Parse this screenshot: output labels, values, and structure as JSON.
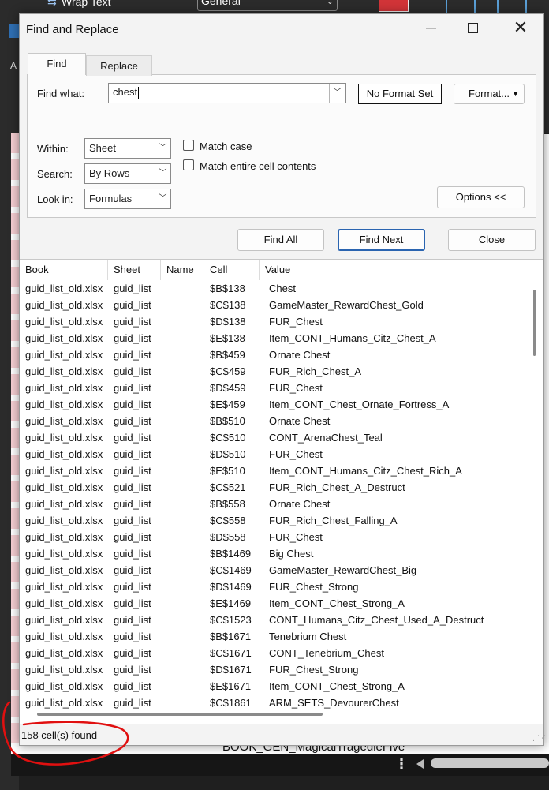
{
  "background": {
    "ribbon_wrap_text": "Wrap Text",
    "ribbon_number_format": "General",
    "left_label": "A",
    "sheet_text_behind": "BOOK_GEN_MagicalTragedieFive"
  },
  "dialog": {
    "title": "Find and Replace",
    "tabs": {
      "find": "Find",
      "replace": "Replace"
    },
    "find_what_label": "Find what:",
    "find_what_value": "chest",
    "no_format_set": "No Format Set",
    "format_button": "Format...",
    "within_label": "Within:",
    "within_value": "Sheet",
    "search_label": "Search:",
    "search_value": "By Rows",
    "lookin_label": "Look in:",
    "lookin_value": "Formulas",
    "match_case": "Match case",
    "match_entire": "Match entire cell contents",
    "options_button": "Options <<",
    "find_all": "Find All",
    "find_next": "Find Next",
    "close": "Close"
  },
  "results": {
    "columns": [
      "Book",
      "Sheet",
      "Name",
      "Cell",
      "Value"
    ],
    "rows": [
      [
        "guid_list_old.xlsx",
        "guid_list",
        "",
        "$B$138",
        "Chest"
      ],
      [
        "guid_list_old.xlsx",
        "guid_list",
        "",
        "$C$138",
        "GameMaster_RewardChest_Gold"
      ],
      [
        "guid_list_old.xlsx",
        "guid_list",
        "",
        "$D$138",
        "FUR_Chest"
      ],
      [
        "guid_list_old.xlsx",
        "guid_list",
        "",
        "$E$138",
        "Item_CONT_Humans_Citz_Chest_A"
      ],
      [
        "guid_list_old.xlsx",
        "guid_list",
        "",
        "$B$459",
        "Ornate Chest"
      ],
      [
        "guid_list_old.xlsx",
        "guid_list",
        "",
        "$C$459",
        "FUR_Rich_Chest_A"
      ],
      [
        "guid_list_old.xlsx",
        "guid_list",
        "",
        "$D$459",
        "FUR_Chest"
      ],
      [
        "guid_list_old.xlsx",
        "guid_list",
        "",
        "$E$459",
        "Item_CONT_Chest_Ornate_Fortress_A"
      ],
      [
        "guid_list_old.xlsx",
        "guid_list",
        "",
        "$B$510",
        "Ornate Chest"
      ],
      [
        "guid_list_old.xlsx",
        "guid_list",
        "",
        "$C$510",
        "CONT_ArenaChest_Teal"
      ],
      [
        "guid_list_old.xlsx",
        "guid_list",
        "",
        "$D$510",
        "FUR_Chest"
      ],
      [
        "guid_list_old.xlsx",
        "guid_list",
        "",
        "$E$510",
        "Item_CONT_Humans_Citz_Chest_Rich_A"
      ],
      [
        "guid_list_old.xlsx",
        "guid_list",
        "",
        "$C$521",
        "FUR_Rich_Chest_A_Destruct"
      ],
      [
        "guid_list_old.xlsx",
        "guid_list",
        "",
        "$B$558",
        "Ornate Chest"
      ],
      [
        "guid_list_old.xlsx",
        "guid_list",
        "",
        "$C$558",
        "FUR_Rich_Chest_Falling_A"
      ],
      [
        "guid_list_old.xlsx",
        "guid_list",
        "",
        "$D$558",
        "FUR_Chest"
      ],
      [
        "guid_list_old.xlsx",
        "guid_list",
        "",
        "$B$1469",
        "Big Chest"
      ],
      [
        "guid_list_old.xlsx",
        "guid_list",
        "",
        "$C$1469",
        "GameMaster_RewardChest_Big"
      ],
      [
        "guid_list_old.xlsx",
        "guid_list",
        "",
        "$D$1469",
        "FUR_Chest_Strong"
      ],
      [
        "guid_list_old.xlsx",
        "guid_list",
        "",
        "$E$1469",
        "Item_CONT_Chest_Strong_A"
      ],
      [
        "guid_list_old.xlsx",
        "guid_list",
        "",
        "$C$1523",
        "CONT_Humans_Citz_Chest_Used_A_Destruct"
      ],
      [
        "guid_list_old.xlsx",
        "guid_list",
        "",
        "$B$1671",
        "Tenebrium Chest"
      ],
      [
        "guid_list_old.xlsx",
        "guid_list",
        "",
        "$C$1671",
        "CONT_Tenebrium_Chest"
      ],
      [
        "guid_list_old.xlsx",
        "guid_list",
        "",
        "$D$1671",
        "FUR_Chest_Strong"
      ],
      [
        "guid_list_old.xlsx",
        "guid_list",
        "",
        "$E$1671",
        "Item_CONT_Chest_Strong_A"
      ],
      [
        "guid_list_old.xlsx",
        "guid_list",
        "",
        "$C$1861",
        "ARM_SETS_DevourerChest"
      ]
    ]
  },
  "status": "158 cell(s) found",
  "colors": {
    "annotation": "#e01010",
    "find_next_border": "#2a64b0"
  }
}
